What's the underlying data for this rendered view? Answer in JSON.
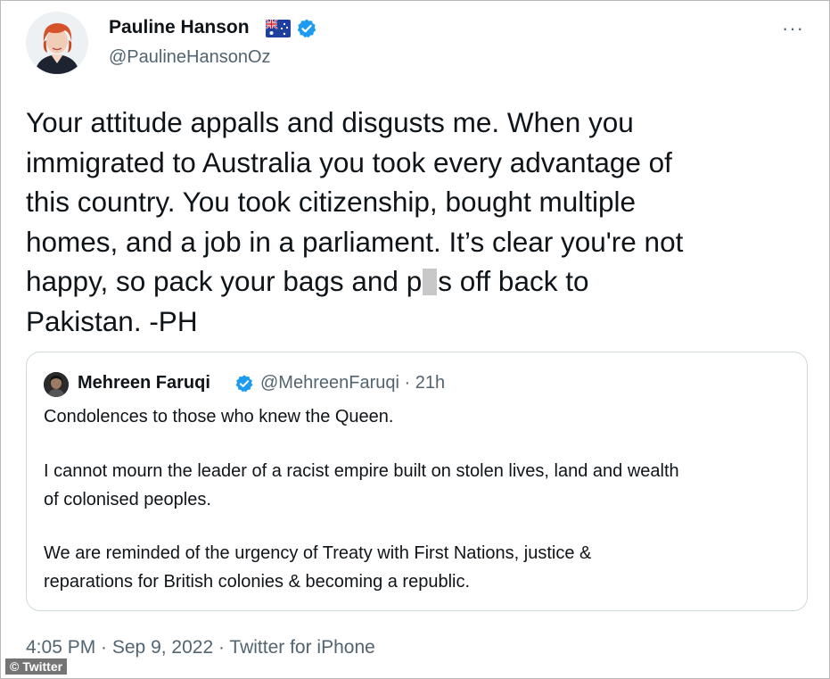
{
  "author": {
    "name": "Pauline Hanson",
    "handle": "@PaulineHansonOz"
  },
  "more_label": "···",
  "tweet": {
    "lines": [
      "Your attitude appalls and disgusts me. When you",
      "immigrated to Australia you took every advantage of",
      "this country. You took citizenship, bought multiple",
      "homes, and a job in a parliament. It’s clear you're not"
    ],
    "line5_before": "happy, so pack your bags and p",
    "line5_after": "s off back to",
    "line6": "Pakistan. -PH"
  },
  "quoted": {
    "name": "Mehreen Faruqi",
    "handle_time": "@MehreenFaruqi · 21h",
    "para1": "Condolences to those who knew the Queen.",
    "para2_lines": [
      "I cannot mourn the leader of a racist empire built on stolen lives, land and wealth",
      "of colonised peoples."
    ],
    "para3_lines": [
      "We are reminded of the urgency of Treaty with First Nations, justice &",
      "reparations for British colonies & becoming a republic."
    ]
  },
  "meta": "4:05 PM · Sep 9, 2022 · Twitter for iPhone",
  "watermark": "© Twitter",
  "colors": {
    "verified_blue": "#1d9bf0",
    "secondary_text": "#536471",
    "border": "#cfd9de"
  }
}
